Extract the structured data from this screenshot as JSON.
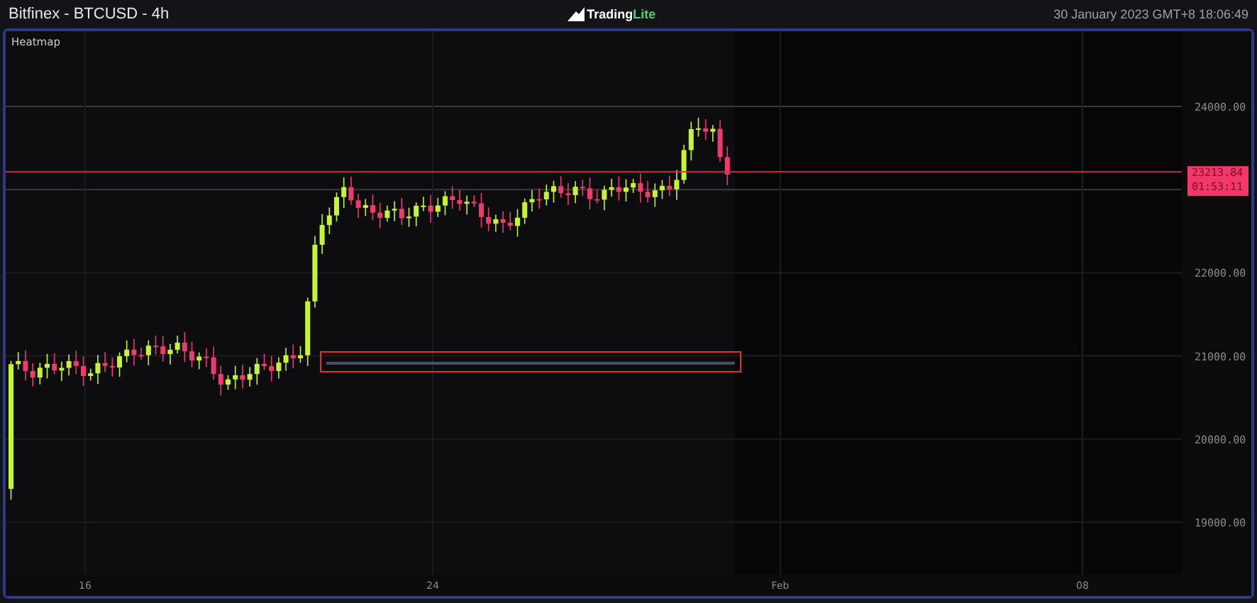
{
  "top_bar": {
    "title": "Bitfinex - BTCUSD - 4h",
    "logo": {
      "word_1": "Trading",
      "word_2": "Lite"
    },
    "datetime": "30 January 2023 GMT+8 18:06:49"
  },
  "chart": {
    "label": "Heatmap",
    "price_axis": [
      "24000.00",
      "22000.00",
      "21000.00",
      "20000.00",
      "19000.00"
    ],
    "time_axis": [
      "16",
      "24",
      "Feb",
      "08"
    ],
    "price_tag": {
      "price": "23213.84",
      "countdown": "01:53:11"
    }
  }
}
